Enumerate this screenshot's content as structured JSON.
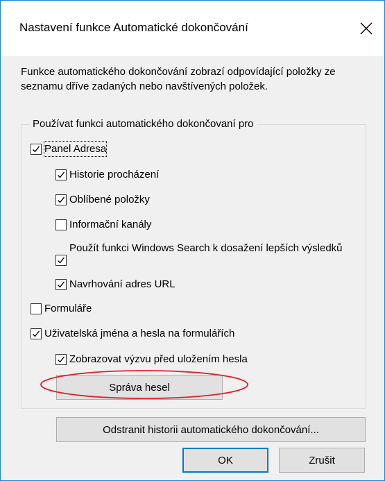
{
  "window": {
    "title": "Nastavení funkce Automatické dokončování",
    "close_glyph": "✕"
  },
  "description": "Funkce automatického dokončování zobrazí odpovídající položky ze seznamu dříve zadaných nebo navštívených položek.",
  "group": {
    "legend": "Používat funkci automatického dokončovaní pro",
    "items": [
      {
        "label": "Panel Adresa",
        "checked": true
      },
      {
        "label": "Historie procházení",
        "checked": true
      },
      {
        "label": "Oblíbené položky",
        "checked": true
      },
      {
        "label": "Informační kanály",
        "checked": false
      },
      {
        "label": "Použít funkci Windows Search k dosažení lepších výsledků",
        "checked": true
      },
      {
        "label": "Navrhování adres URL",
        "checked": true
      },
      {
        "label": "Formuláře",
        "checked": false
      },
      {
        "label": "Uživatelská jména a hesla na formulářích",
        "checked": true
      },
      {
        "label": "Zobrazovat výzvu před uložením hesla",
        "checked": true
      }
    ],
    "manage_passwords_button": "Správa hesel"
  },
  "buttons": {
    "clear_history": "Odstranit historii automatického dokončování...",
    "ok": "OK",
    "cancel": "Zrušit"
  },
  "colors": {
    "window_border": "#1883d7",
    "dialog_bg": "#f0f0f0",
    "annotation": "#e0202a",
    "default_button_border": "#0078d7"
  },
  "icons": {
    "close": "close-icon",
    "checkmark": "checkmark-icon"
  }
}
